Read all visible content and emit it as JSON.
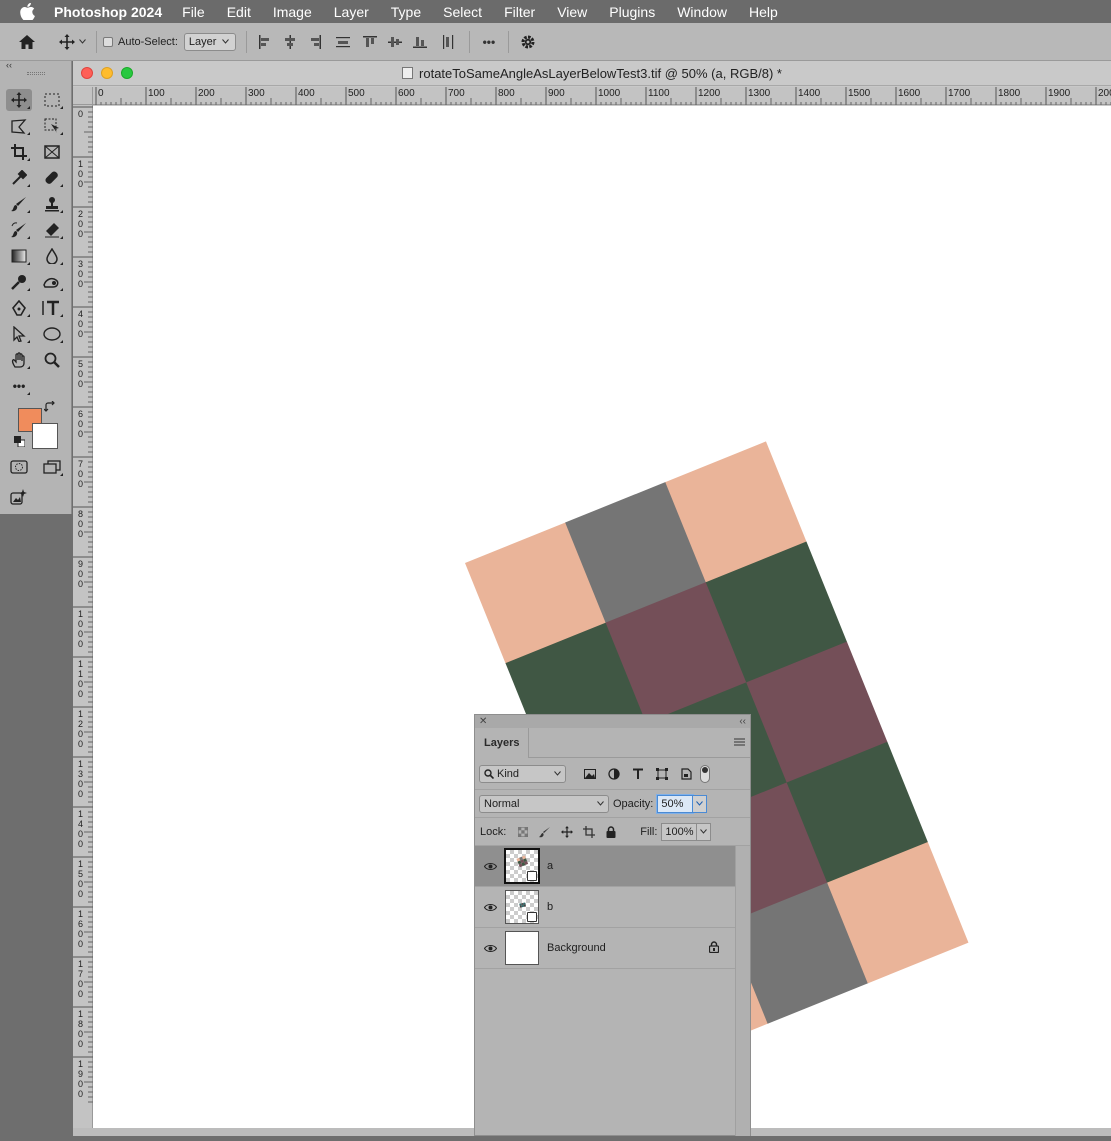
{
  "menubar": {
    "app_name": "Photoshop 2024",
    "items": [
      "File",
      "Edit",
      "Image",
      "Layer",
      "Type",
      "Select",
      "Filter",
      "View",
      "Plugins",
      "Window",
      "Help"
    ]
  },
  "optionsbar": {
    "auto_select_label": "Auto-Select:",
    "auto_select_value": "Layer",
    "more_label": "•••"
  },
  "toolbar": {
    "foreground_color": "#f08c5c",
    "background_color": "#ffffff"
  },
  "document": {
    "title": "rotateToSameAngleAsLayerBelowTest3.tif @ 50% (a, RGB/8) *",
    "ruler_h_labels": [
      "0",
      "100",
      "200",
      "300",
      "400",
      "500",
      "600",
      "700",
      "800",
      "900",
      "1000",
      "1100",
      "1200",
      "1300",
      "1400",
      "1500",
      "1600",
      "1700",
      "1800",
      "1900",
      "200"
    ],
    "ruler_v_labels": [
      "0",
      "100",
      "200",
      "300",
      "400",
      "500",
      "600",
      "700",
      "800",
      "900",
      "1000",
      "1100",
      "1200",
      "1300",
      "1400",
      "1500",
      "1600",
      "1700",
      "1800",
      "1900"
    ]
  },
  "artwork": {
    "grid_rows": 5,
    "grid_cols": 3,
    "rotation_deg": -22,
    "colors": {
      "peach": "#eab499",
      "gray": "#757575",
      "mauve": "#744f58",
      "green": "#405744"
    },
    "cells": [
      [
        "peach",
        "gray",
        "peach"
      ],
      [
        "green",
        "mauve",
        "green"
      ],
      [
        "mauve",
        "green",
        "mauve"
      ],
      [
        "mauve",
        "mauve",
        "green"
      ],
      [
        "peach",
        "gray",
        "peach"
      ]
    ]
  },
  "layers_panel": {
    "tab_label": "Layers",
    "filter_kind": "Kind",
    "blend_mode": "Normal",
    "opacity_label": "Opacity:",
    "opacity_value": "50%",
    "lock_label": "Lock:",
    "fill_label": "Fill:",
    "fill_value": "100%",
    "layers": [
      {
        "name": "a",
        "selected": true,
        "smart_object": true
      },
      {
        "name": "b",
        "selected": false,
        "smart_object": true
      },
      {
        "name": "Background",
        "selected": false,
        "locked": true
      }
    ]
  }
}
